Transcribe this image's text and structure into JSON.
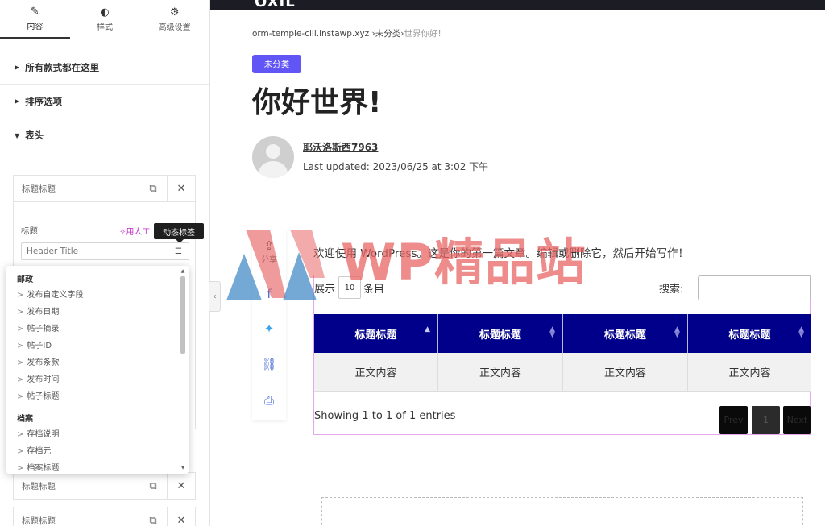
{
  "panel": {
    "tabs": [
      {
        "label": "内容",
        "icon": "pencil-icon",
        "glyph": "✎"
      },
      {
        "label": "样式",
        "icon": "contrast-icon",
        "glyph": "◐"
      },
      {
        "label": "高级设置",
        "icon": "gear-icon",
        "glyph": "⚙"
      }
    ],
    "sections": {
      "all_styles": "所有款式都在这里",
      "sort_options": "排序选项",
      "table_header": "表头"
    },
    "repeater_items": [
      "标题标题",
      "标题标题",
      "标题标题"
    ],
    "field": {
      "label": "标题",
      "ai_link": "✧用人工",
      "tooltip": "动态标签",
      "placeholder": "Header Title"
    },
    "dropdown": {
      "group1": "邮政",
      "items1": [
        "发布自定义字段",
        "发布日期",
        "帖子摘录",
        "帖子ID",
        "发布条款",
        "发布时间",
        "帖子标题"
      ],
      "group2": "档案",
      "items2": [
        "存档说明",
        "存档元",
        "档案标题"
      ]
    }
  },
  "preview": {
    "logo_text": "OXIL",
    "breadcrumb": {
      "site": "orm-temple-cili.instawp.xyz",
      "sep1": " ›",
      "category": "未分类",
      "sep2": "›",
      "current": "世界你好!"
    },
    "category_badge": "未分类",
    "title": "你好世界!",
    "author": "耶沃洛斯西7963",
    "updated": "Last updated: 2023/06/25 at 3:02 下午",
    "share_label": "分享",
    "intro": "欢迎使用 WordPress。这是你的第一篇文章。编辑或删除它，然后开始写作！",
    "table": {
      "show_label": "展示",
      "show_value": "10",
      "entries_label": "条目",
      "search_label": "搜索:",
      "headers": [
        "标题标题",
        "标题标题",
        "标题标题",
        "标题标题"
      ],
      "row": [
        "正文内容",
        "正文内容",
        "正文内容",
        "正文内容"
      ],
      "info": "Showing 1 to 1 of 1 entries",
      "prev": "Prev",
      "page": "1",
      "next": "Next"
    },
    "watermark": "WP精品站"
  }
}
